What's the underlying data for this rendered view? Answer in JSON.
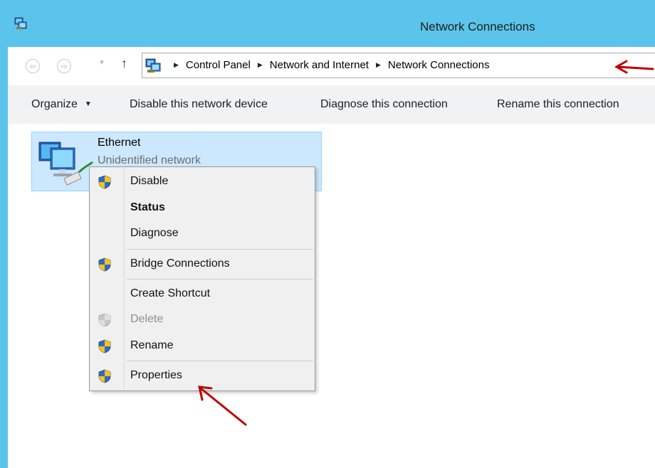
{
  "window": {
    "title": "Network Connections"
  },
  "navigation": {
    "back_glyph": "⇦",
    "forward_glyph": "⇨",
    "dropdown_glyph": "▼",
    "up_glyph": "↑",
    "breadcrumbs": [
      "Control Panel",
      "Network and Internet",
      "Network Connections"
    ]
  },
  "toolbar": {
    "organize": "Organize",
    "disable_device": "Disable this network device",
    "diagnose": "Diagnose this connection",
    "rename": "Rename this connection"
  },
  "connection": {
    "name": "Ethernet",
    "status": "Unidentified network"
  },
  "context_menu": {
    "items": [
      {
        "label": "Disable",
        "icon": "uac-shield-icon"
      },
      {
        "label": "Status",
        "bold": true
      },
      {
        "label": "Diagnose"
      },
      {
        "label": "Bridge Connections",
        "icon": "uac-shield-icon"
      },
      {
        "label": "Create Shortcut"
      },
      {
        "label": "Delete",
        "icon": "uac-shield-icon",
        "disabled": true
      },
      {
        "label": "Rename",
        "icon": "uac-shield-icon"
      },
      {
        "label": "Properties",
        "icon": "uac-shield-icon"
      }
    ]
  },
  "colors": {
    "title_bar": "#5bc4ea",
    "selection": "#cce8ff",
    "annotation_arrow": "#c00000",
    "shield_blue": "#2f6bc4",
    "shield_yellow": "#f4c31a"
  }
}
